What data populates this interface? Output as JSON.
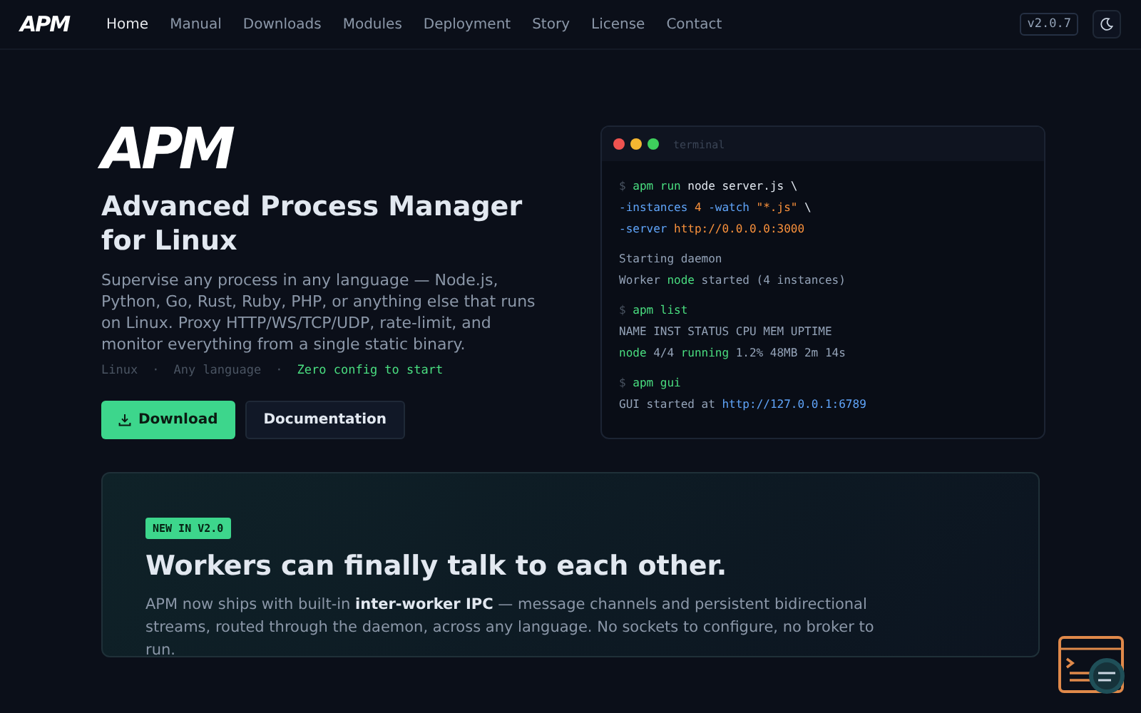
{
  "nav": {
    "logo": "APM",
    "items": [
      {
        "label": "Home",
        "selected": true
      },
      {
        "label": "Manual",
        "selected": false
      },
      {
        "label": "Downloads",
        "selected": false
      },
      {
        "label": "Modules",
        "selected": false
      },
      {
        "label": "Deployment",
        "selected": false
      },
      {
        "label": "Story",
        "selected": false
      },
      {
        "label": "License",
        "selected": false
      },
      {
        "label": "Contact",
        "selected": false
      }
    ],
    "version": "v2.0.7"
  },
  "hero": {
    "logo": "APM",
    "title": "Advanced Process Manager for Linux",
    "description": "Supervise any process in any language — Node.js, Python, Go, Rust, Ruby, PHP, or anything else that runs on Linux. Proxy HTTP/WS/TCP/UDP, rate-limit, and monitor everything from a single static binary.",
    "tags": [
      {
        "label": "Linux",
        "highlighted": false
      },
      {
        "label": "Any language",
        "highlighted": false
      },
      {
        "label": "Zero config to start",
        "highlighted": true
      }
    ],
    "separator": "·",
    "buttons": [
      {
        "label": "Download",
        "kind": "primary"
      },
      {
        "label": "Documentation",
        "kind": "secondary"
      }
    ]
  },
  "terminal": {
    "title": "terminal",
    "blocks": [
      [
        [
          {
            "kind": "prompt",
            "text": "$"
          },
          {
            "kind": "command",
            "text": "apm run"
          },
          {
            "kind": "plain",
            "text": "node server.js \\"
          }
        ],
        [
          {
            "kind": "flag",
            "text": "-instances"
          },
          {
            "kind": "value",
            "text": "4"
          },
          {
            "kind": "flag",
            "text": "-watch"
          },
          {
            "kind": "value",
            "text": "\"*.js\""
          },
          {
            "kind": "plain",
            "text": "\\"
          }
        ],
        [
          {
            "kind": "flag",
            "text": "-server"
          },
          {
            "kind": "value",
            "text": "http://0.0.0.0:3000"
          }
        ]
      ],
      [
        [
          {
            "kind": "output",
            "text": "Starting daemon"
          }
        ],
        [
          {
            "kind": "output",
            "text": "Worker"
          },
          {
            "kind": "command",
            "text": "node"
          },
          {
            "kind": "output",
            "text": "started (4 instances)"
          }
        ]
      ],
      [
        [
          {
            "kind": "prompt",
            "text": "$"
          },
          {
            "kind": "command",
            "text": "apm list"
          }
        ],
        [
          {
            "kind": "output",
            "text": "NAME INST STATUS CPU MEM UPTIME"
          }
        ],
        [
          {
            "kind": "command",
            "text": "node"
          },
          {
            "kind": "output",
            "text": "4/4"
          },
          {
            "kind": "command",
            "text": "running"
          },
          {
            "kind": "output",
            "text": "1.2% 48MB 2m 14s"
          }
        ]
      ],
      [
        [
          {
            "kind": "prompt",
            "text": "$"
          },
          {
            "kind": "command",
            "text": "apm gui"
          }
        ],
        [
          {
            "kind": "output",
            "text": "GUI started at"
          },
          {
            "kind": "link",
            "text": "http://127.0.0.1:6789"
          }
        ]
      ]
    ]
  },
  "feature": {
    "badge": "NEW IN V2.0",
    "title": "Workers can finally talk to each other.",
    "text": "APM now ships with built-in **inter-worker IPC** — message channels and persistent bidirectional streams, routed through the daemon, across any language. No sockets to configure, no broker to run."
  }
}
